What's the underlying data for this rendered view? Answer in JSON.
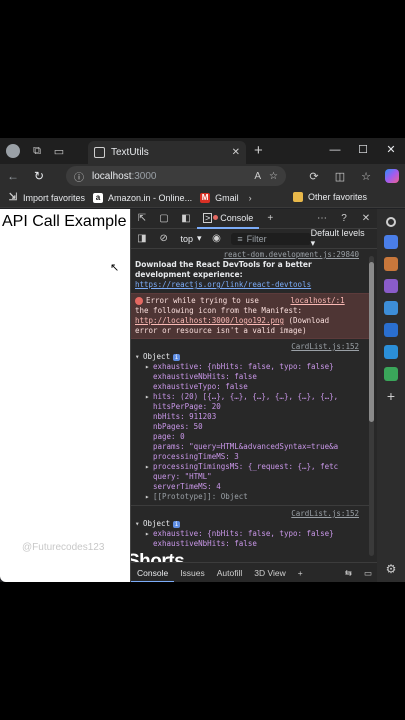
{
  "browser": {
    "tab_title": "TextUtils",
    "address": {
      "host": "localhost",
      "port": ":3000"
    },
    "favorites": [
      "Import favorites",
      "Amazon.in - Online...",
      "Gmail",
      "Other favorites"
    ]
  },
  "page": {
    "heading": "API Call Example",
    "watermark": "@Futurecodes123"
  },
  "devtools": {
    "console_tab": "Console",
    "context": "top",
    "filter_placeholder": "Filter",
    "levels": "Default levels",
    "messages": {
      "src1": "react-dom.development.js:29840",
      "devtools_msg_1": "Download the React DevTools for a better",
      "devtools_msg_2": "development experience:",
      "devtools_link": "https://reactjs.org/link/react-devtools",
      "error_1": "Error while trying to use",
      "error_src": "localhost/:1",
      "error_2": "the following icon from the Manifest:",
      "error_link": "http://localhost:3000/logo192.png",
      "error_3": " (Download",
      "error_4": "error or resource isn't a valid image)",
      "src2": "CardList.js:152",
      "object_label": "Object",
      "exhaustive_1": "exhaustive: {nbHits: false, typo: false}",
      "exhaustiveNbHits": "exhaustiveNbHits: false",
      "exhaustiveTypo": "exhaustiveTypo: false",
      "hits": "hits: (20) [{…}, {…}, {…}, {…}, {…}, {…},",
      "hitsPerPage": "hitsPerPage: 20",
      "nbHits": "nbHits: 911203",
      "nbPages": "nbPages: 50",
      "page": "page: 0",
      "params": "params: \"query=HTML&advancedSyntax=true&a",
      "processingTimeMS": "processingTimeMS: 3",
      "processingTimingsMS": "processingTimingsMS: {_request: {…}, fetc",
      "query": "query: \"HTML\"",
      "serverTimeMS": "serverTimeMS: 4",
      "prototype": "[[Prototype]]: Object",
      "src3": "CardList.js:152",
      "object_label_2": "Object",
      "exhaustive_2": "exhaustive: {nbHits: false, typo: false}",
      "exhaustiveNbHits_2": "exhaustiveNbHits: false"
    },
    "drawer_tabs": [
      "Console",
      "Issues",
      "Autofill",
      "3D View"
    ]
  },
  "overlay": {
    "shorts": "Shorts"
  },
  "colors": {
    "link": "#7cacf8",
    "error_bg": "#4e3534",
    "key": "#c997e9",
    "string": "#f28b54",
    "number": "#9980ff"
  }
}
